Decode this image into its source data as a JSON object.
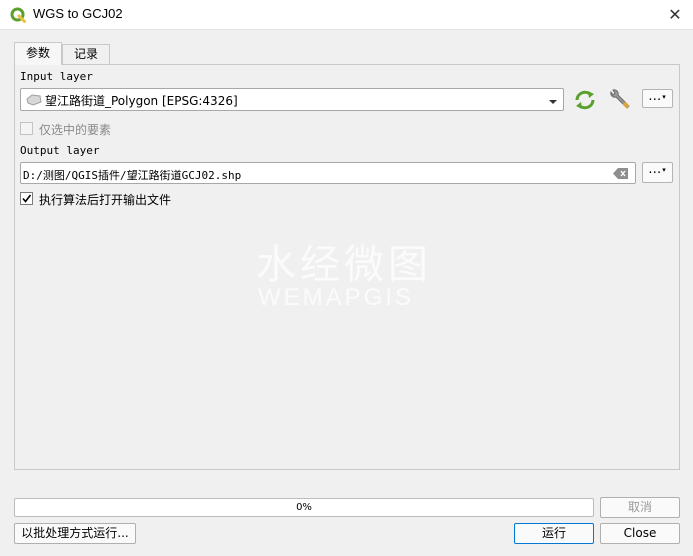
{
  "window": {
    "title": "WGS to GCJ02"
  },
  "tabs": [
    {
      "label": "参数",
      "active": true
    },
    {
      "label": "记录",
      "active": false
    }
  ],
  "input_layer": {
    "label": "Input layer",
    "value": "望江路街道_Polygon [EPSG:4326]",
    "more_label": "…"
  },
  "selected_only": {
    "label": "仅选中的要素",
    "checked": false,
    "enabled": false
  },
  "output_layer": {
    "label": "Output layer",
    "value": "D:/测图/QGIS插件/望江路街道GCJ02.shp",
    "more_label": "…"
  },
  "open_output": {
    "label": "执行算法后打开输出文件",
    "checked": true
  },
  "watermark": {
    "cn": "水经微图",
    "en": "WEMAPGIS"
  },
  "progress": {
    "text": "0%",
    "value": 0
  },
  "buttons": {
    "cancel": "取消",
    "batch": "以批处理方式运行...",
    "run": "运行",
    "close": "Close"
  },
  "colors": {
    "accent": "#5aa02c",
    "run_border": "#0078d7"
  }
}
